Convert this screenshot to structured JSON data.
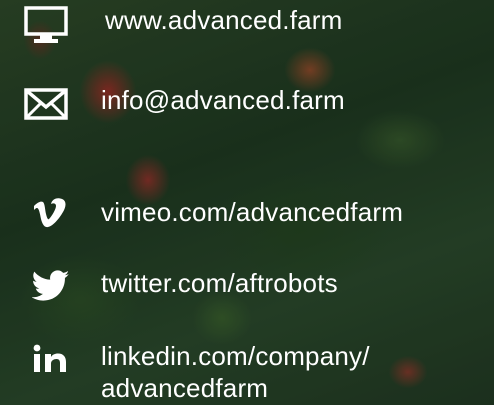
{
  "contacts": {
    "website": {
      "icon": "monitor-icon",
      "text": "www.advanced.farm"
    },
    "email": {
      "icon": "envelope-icon",
      "text": "info@advanced.farm"
    },
    "vimeo": {
      "icon": "vimeo-icon",
      "text": "vimeo.com/advancedfarm"
    },
    "twitter": {
      "icon": "twitter-icon",
      "text": "twitter.com/aftrobots"
    },
    "linkedin": {
      "icon": "linkedin-icon",
      "text_line1": "linkedin.com/company/",
      "text_line2": "advancedfarm"
    }
  },
  "colors": {
    "text": "#ffffff",
    "background": "#243a22"
  }
}
